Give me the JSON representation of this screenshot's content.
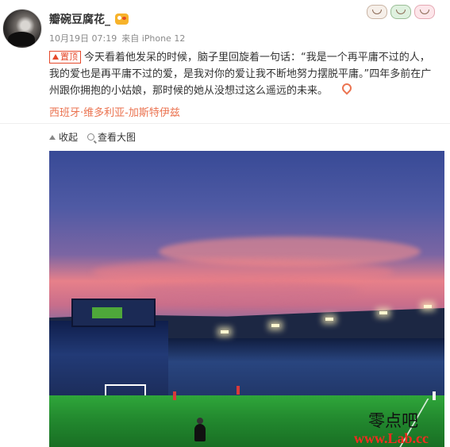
{
  "author": {
    "name": "瓣碗豆腐花_"
  },
  "meta": {
    "time": "10月19日 07:19",
    "source": "来自 iPhone 12"
  },
  "post": {
    "pin_label": "置顶",
    "text": "今天看着他发呆的时候，脑子里回旋着一句话：“我是一个再平庸不过的人，我的爱也是再平庸不过的爱，是我对你的爱让我不断地努力摆脱平庸。”四年多前在广州跟你拥抱的小姑娘，那时候的她从没想过这么遥远的未来。",
    "location": "西班牙·维多利亚-加斯特伊兹"
  },
  "actions": {
    "collapse": "收起",
    "view_large": "查看大图"
  },
  "watermark": {
    "site_name": "零点吧",
    "url": "www.Lab.cc"
  },
  "colors": {
    "accent": "#eb7350",
    "pin": "#e5492b",
    "text": "#333333",
    "muted": "#8a8a8a"
  }
}
